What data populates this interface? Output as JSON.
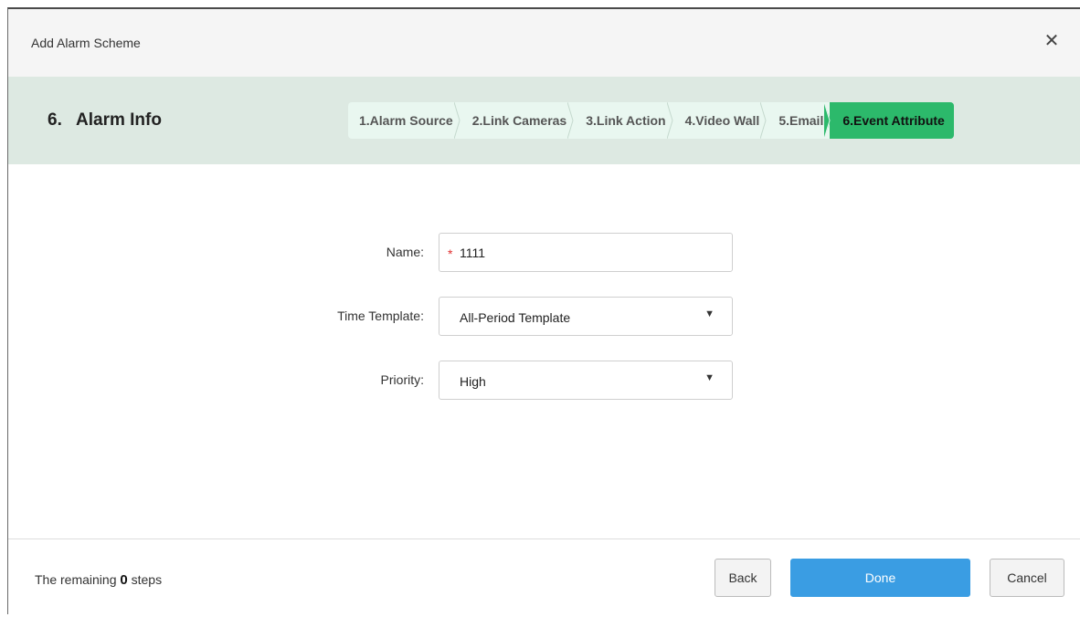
{
  "dialog": {
    "title": "Add Alarm Scheme",
    "close_glyph": "✕"
  },
  "step_header": {
    "number": "6.",
    "title": "Alarm Info",
    "steps": [
      {
        "label": "1.Alarm Source",
        "active": false
      },
      {
        "label": "2.Link Cameras",
        "active": false
      },
      {
        "label": "3.Link Action",
        "active": false
      },
      {
        "label": "4.Video Wall",
        "active": false
      },
      {
        "label": "5.Email",
        "active": false
      },
      {
        "label": "6.Event Attribute",
        "active": true
      }
    ],
    "colors": {
      "header_bg": "#dde9e2",
      "step_bg": "#e9f7f0",
      "active_step_bg": "#2cb96b"
    }
  },
  "form": {
    "name": {
      "label": "Name:",
      "required_mark": "*",
      "value": "1111"
    },
    "time_template": {
      "label": "Time Template:",
      "value": "All-Period Template",
      "arrow_glyph": "▼"
    },
    "priority": {
      "label": "Priority:",
      "value": "High",
      "arrow_glyph": "▼"
    }
  },
  "footer": {
    "remaining_prefix": "The remaining",
    "remaining_count": "0",
    "remaining_suffix": "steps",
    "back_label": "Back",
    "done_label": "Done",
    "cancel_label": "Cancel",
    "colors": {
      "done_bg": "#3a9de3"
    }
  }
}
